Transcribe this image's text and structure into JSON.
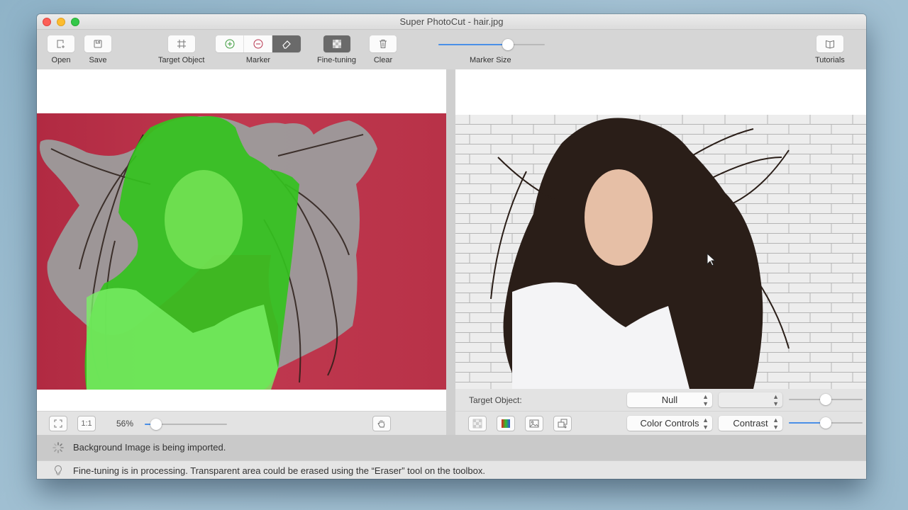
{
  "window": {
    "title": "Super PhotoCut - hair.jpg"
  },
  "toolbar": {
    "open_label": "Open",
    "save_label": "Save",
    "target_object_label": "Target Object",
    "marker_label": "Marker",
    "fine_tuning_label": "Fine-tuning",
    "clear_label": "Clear",
    "marker_size_label": "Marker Size",
    "marker_size_value": 0.65,
    "tutorials_label": "Tutorials",
    "active_marker": "eraser"
  },
  "left_panel": {
    "fit_button": "fit-to-window",
    "actual_size_label": "1:1",
    "zoom_percent": "56%",
    "zoom_slider_value": 0.14
  },
  "right_panel": {
    "target_object_label": "Target Object:",
    "target_object_value": "Null",
    "secondary_select_value": "",
    "top_slider_value": 0.5,
    "filter_category_value": "Color Controls",
    "filter_param_value": "Contrast",
    "filter_slider_value": 0.5
  },
  "status": {
    "import_message": "Background Image is being imported.",
    "hint_message": "Fine-tuning is in processing. Transparent area could be erased using the “Eraser” tool on the toolbox."
  },
  "colors": {
    "accent": "#4a8fe7",
    "mask_keep": "#33c51f",
    "mask_unknown": "#9a9a9a",
    "source_background": "#bb3149"
  }
}
